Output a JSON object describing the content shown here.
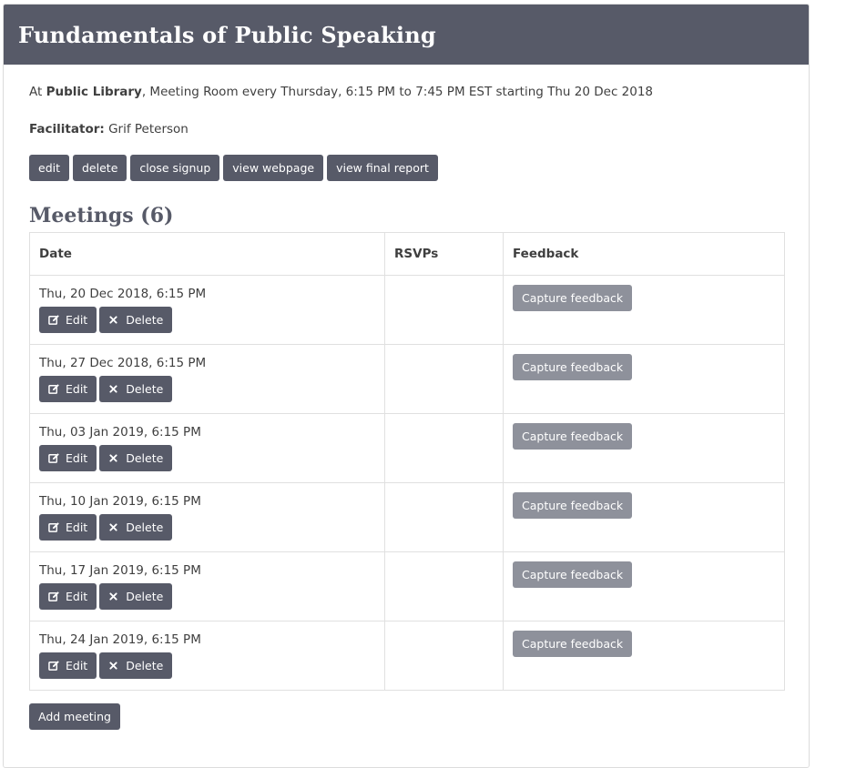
{
  "header": {
    "title": "Fundamentals of Public Speaking"
  },
  "info": {
    "prefix": "At",
    "venue": "Public Library",
    "details": ", Meeting Room every Thursday, 6:15 PM to 7:45 PM EST starting Thu 20 Dec 2018"
  },
  "facilitator": {
    "label": "Facilitator:",
    "name": "Grif Peterson"
  },
  "actions": {
    "edit": "edit",
    "delete": "delete",
    "close_signup": "close signup",
    "view_webpage": "view webpage",
    "view_final_report": "view final report"
  },
  "meetings": {
    "heading": "Meetings (6)",
    "columns": {
      "date": "Date",
      "rsvps": "RSVPs",
      "feedback": "Feedback"
    },
    "edit_label": "Edit",
    "delete_label": "Delete",
    "feedback_label": "Capture feedback",
    "rows": [
      {
        "date": "Thu, 20 Dec 2018, 6:15 PM",
        "rsvps": ""
      },
      {
        "date": "Thu, 27 Dec 2018, 6:15 PM",
        "rsvps": ""
      },
      {
        "date": "Thu, 03 Jan 2019, 6:15 PM",
        "rsvps": ""
      },
      {
        "date": "Thu, 10 Jan 2019, 6:15 PM",
        "rsvps": ""
      },
      {
        "date": "Thu, 17 Jan 2019, 6:15 PM",
        "rsvps": ""
      },
      {
        "date": "Thu, 24 Jan 2019, 6:15 PM",
        "rsvps": ""
      }
    ],
    "add_label": "Add meeting"
  },
  "colors": {
    "header_bg": "#575a68",
    "button": "#575a68",
    "button_muted": "#8e919b"
  },
  "icons": {
    "edit": "edit-square-icon",
    "delete": "close-x-icon"
  }
}
